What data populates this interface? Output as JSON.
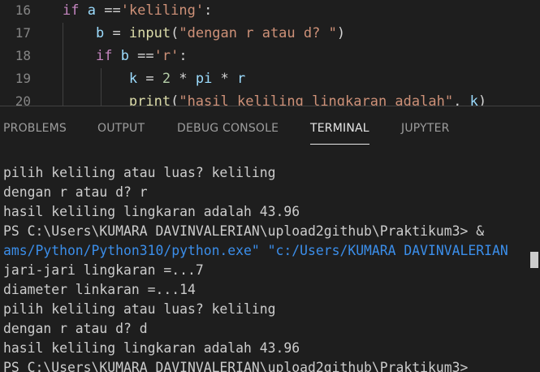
{
  "editor": {
    "lines": [
      {
        "num": "16",
        "tokens": [
          {
            "t": "if",
            "c": "kw"
          },
          {
            "t": " ",
            "c": "op"
          },
          {
            "t": "a",
            "c": "id"
          },
          {
            "t": " ==",
            "c": "op"
          },
          {
            "t": "'keliling'",
            "c": "str"
          },
          {
            "t": ":",
            "c": "op"
          }
        ]
      },
      {
        "num": "17",
        "tokens": [
          {
            "t": "    ",
            "c": "op"
          },
          {
            "t": "b",
            "c": "id"
          },
          {
            "t": " = ",
            "c": "op"
          },
          {
            "t": "input",
            "c": "fn"
          },
          {
            "t": "(",
            "c": "op"
          },
          {
            "t": "\"dengan r atau d? \"",
            "c": "str"
          },
          {
            "t": ")",
            "c": "op"
          }
        ]
      },
      {
        "num": "18",
        "tokens": [
          {
            "t": "    ",
            "c": "op"
          },
          {
            "t": "if",
            "c": "kw"
          },
          {
            "t": " ",
            "c": "op"
          },
          {
            "t": "b",
            "c": "id"
          },
          {
            "t": " ==",
            "c": "op"
          },
          {
            "t": "'r'",
            "c": "str"
          },
          {
            "t": ":",
            "c": "op"
          }
        ]
      },
      {
        "num": "19",
        "tokens": [
          {
            "t": "        ",
            "c": "op"
          },
          {
            "t": "k",
            "c": "id"
          },
          {
            "t": " = ",
            "c": "op"
          },
          {
            "t": "2",
            "c": "num"
          },
          {
            "t": " * ",
            "c": "op"
          },
          {
            "t": "pi",
            "c": "id"
          },
          {
            "t": " * ",
            "c": "op"
          },
          {
            "t": "r",
            "c": "id"
          }
        ]
      },
      {
        "num": "20",
        "tokens": [
          {
            "t": "        ",
            "c": "op"
          },
          {
            "t": "print",
            "c": "fn"
          },
          {
            "t": "(",
            "c": "op"
          },
          {
            "t": "\"hasil keliling lingkaran adalah\"",
            "c": "str"
          },
          {
            "t": ", ",
            "c": "op"
          },
          {
            "t": "k",
            "c": "id"
          },
          {
            "t": ")",
            "c": "op"
          }
        ]
      }
    ]
  },
  "panel": {
    "tabs": [
      {
        "label": "PROBLEMS",
        "active": false
      },
      {
        "label": "OUTPUT",
        "active": false
      },
      {
        "label": "DEBUG CONSOLE",
        "active": false
      },
      {
        "label": "TERMINAL",
        "active": true
      },
      {
        "label": "JUPYTER",
        "active": false
      }
    ]
  },
  "terminal": {
    "lines": [
      {
        "text": "pilih keliling atau luas? keliling",
        "style": "normal"
      },
      {
        "text": "dengan r atau d? r",
        "style": "normal"
      },
      {
        "text": "hasil keliling lingkaran adalah 43.96",
        "style": "normal"
      },
      {
        "text": "PS C:\\Users\\KUMARA DAVINVALERIAN\\upload2github\\Praktikum3> & ",
        "style": "normal"
      },
      {
        "text": "ams/Python/Python310/python.exe\" \"c:/Users/KUMARA DAVINVALERIAN",
        "style": "blue"
      },
      {
        "text": "jari-jari lingkaran =...7",
        "style": "normal"
      },
      {
        "text": "diameter linkaran =...14",
        "style": "normal"
      },
      {
        "text": "pilih keliling atau luas? keliling",
        "style": "normal"
      },
      {
        "text": "dengan r atau d? d",
        "style": "normal"
      },
      {
        "text": "hasil keliling lingkaran adalah 43.96",
        "style": "normal"
      },
      {
        "text": "PS C:\\Users\\KUMARA DAVINVALERIAN\\upload2github\\Praktikum3> ",
        "style": "normal"
      }
    ]
  }
}
